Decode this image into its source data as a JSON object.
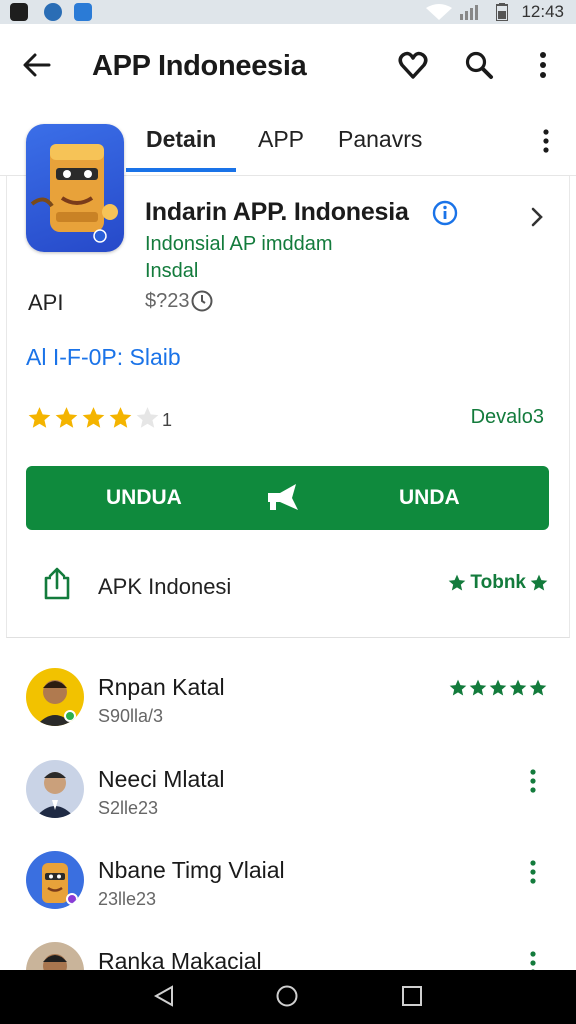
{
  "status_bar": {
    "time": "12:43",
    "left_icons": [
      "notification-icon",
      "navigation-icon",
      "vpn-icon"
    ],
    "right_icons": [
      "wifi-icon",
      "signal-icon",
      "battery-icon"
    ]
  },
  "app_bar": {
    "title": "APP Indoneesia",
    "icons": [
      "back-arrow-icon",
      "wishlist-heart-icon",
      "search-icon",
      "more-vert-icon"
    ]
  },
  "tabs": [
    {
      "label": "Detain",
      "selected": true
    },
    {
      "label": "APP",
      "selected": false
    },
    {
      "label": "Panavrs",
      "selected": false
    }
  ],
  "app": {
    "name": "Indarin APP. Indonesia",
    "subtitle_line1": "Indonsial AP imddam",
    "subtitle_line2": "Insdal",
    "api_label": "API",
    "price": "$?23",
    "link": "Al I-F-0P: Slaib",
    "rating_stars": 4,
    "rating_count": "1",
    "developer": "Devalo3",
    "install": {
      "left_label": "UNDUA",
      "right_label": "UNDA"
    },
    "share_label": "APK Indonesi",
    "top_label": "Tobnk"
  },
  "reviews": [
    {
      "name": "Rnpan Katal",
      "meta": "S90lla/3",
      "stars": 5,
      "action": "stars"
    },
    {
      "name": "Neeci Mlatal",
      "meta": "S2lle23",
      "action": "more"
    },
    {
      "name": "Nbane Timg  Vlaial",
      "meta": "23lle23",
      "action": "more"
    },
    {
      "name": "Ranka Makacial",
      "meta": "",
      "action": "more"
    }
  ],
  "colors": {
    "accent_green": "#0f8a3d",
    "link_blue": "#1a73e8",
    "star_yellow": "#f4b400"
  },
  "nav_bar": {
    "buttons": [
      "back-triangle-icon",
      "home-circle-icon",
      "recents-square-icon"
    ]
  }
}
